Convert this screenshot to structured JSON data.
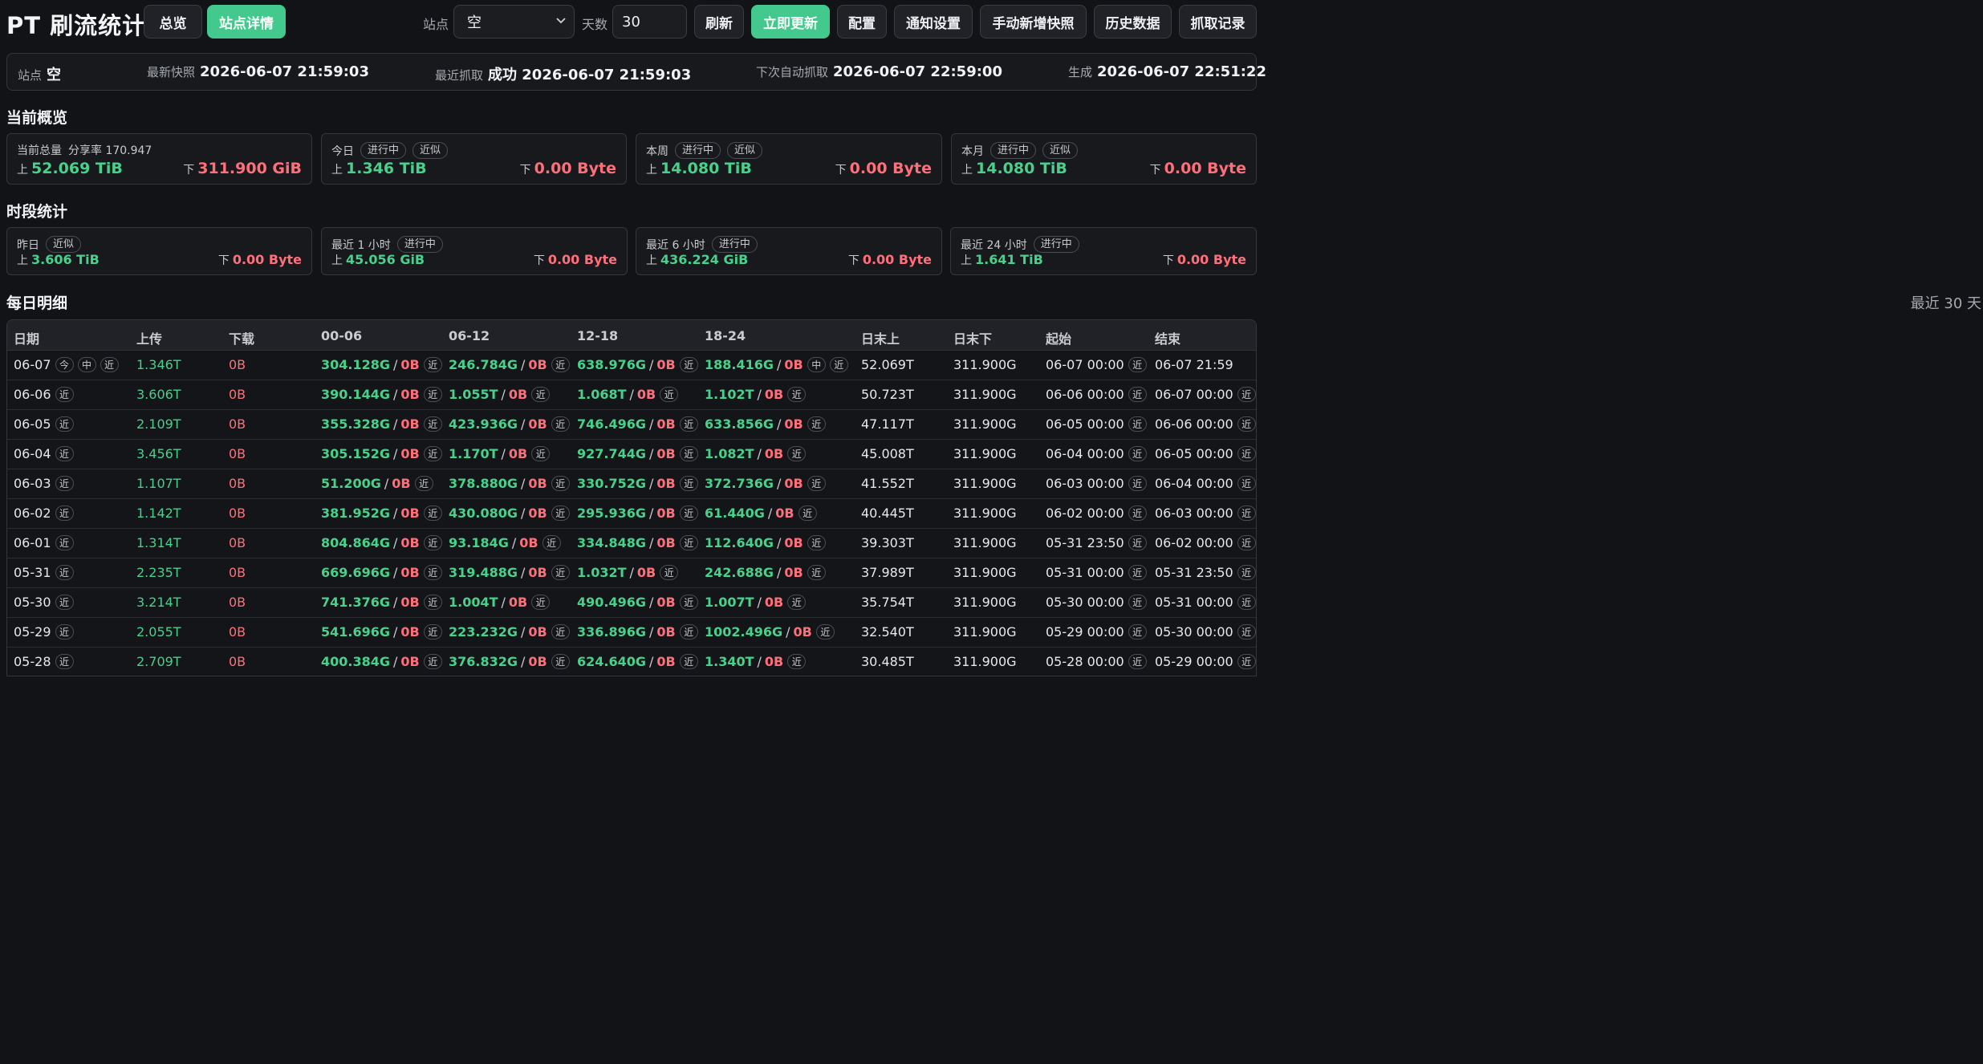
{
  "app": {
    "title": "PT 刷流统计"
  },
  "toolbar": {
    "overview": "总览",
    "site_detail": "站点详情",
    "site_label": "站点",
    "site_value": "空",
    "days_label": "天数",
    "days_value": "30",
    "refresh": "刷新",
    "update_now": "立即更新",
    "config": "配置",
    "notify": "通知设置",
    "manual_snapshot": "手动新增快照",
    "history": "历史数据",
    "fetch_log": "抓取记录"
  },
  "info": {
    "site_label": "站点",
    "site_value": "空",
    "latest_label": "最新快照",
    "latest_value": "2026-06-07 21:59:03",
    "fetch_label": "最近抓取",
    "fetch_value": "成功 2026-06-07 21:59:03",
    "next_label": "下次自动抓取",
    "next_value": "2026-06-07 22:59:00",
    "gen_label": "生成",
    "gen_value": "2026-06-07 22:51:22"
  },
  "sections": {
    "overview": "当前概览",
    "period": "时段统计",
    "daily": "每日明细",
    "recent": "最近 30 天"
  },
  "common": {
    "up": "上",
    "down": "下",
    "in_progress": "进行中",
    "approx": "近似"
  },
  "overview": {
    "total": {
      "label": "当前总量",
      "ratio": "分享率 170.947",
      "up": "52.069 TiB",
      "down": "311.900 GiB"
    },
    "today": {
      "label": "今日",
      "up": "1.346 TiB",
      "down": "0.00 Byte"
    },
    "week": {
      "label": "本周",
      "up": "14.080 TiB",
      "down": "0.00 Byte"
    },
    "month": {
      "label": "本月",
      "up": "14.080 TiB",
      "down": "0.00 Byte"
    }
  },
  "period": {
    "yesterday": {
      "label": "昨日",
      "up": "3.606 TiB",
      "down": "0.00 Byte"
    },
    "h1": {
      "label": "最近 1 小时",
      "up": "45.056 GiB",
      "down": "0.00 Byte"
    },
    "h6": {
      "label": "最近 6 小时",
      "up": "436.224 GiB",
      "down": "0.00 Byte"
    },
    "h24": {
      "label": "最近 24 小时",
      "up": "1.641 TiB",
      "down": "0.00 Byte"
    }
  },
  "table": {
    "headers": [
      "日期",
      "上传",
      "下载",
      "00-06",
      "06-12",
      "12-18",
      "18-24",
      "日末上",
      "日末下",
      "起始",
      "结束"
    ],
    "marks": {
      "today": "今",
      "mid": "中",
      "approx": "近"
    },
    "rows": [
      {
        "date": "06-07",
        "up": "1.346T",
        "down": "0B",
        "s1": "304.128G",
        "s2": "246.784G",
        "s3": "638.976G",
        "s4": "188.416G",
        "eu": "52.069T",
        "ed": "311.900G",
        "start": "06-07 00:00",
        "end": "06-07 21:59"
      },
      {
        "date": "06-06",
        "up": "3.606T",
        "down": "0B",
        "s1": "390.144G",
        "s2": "1.055T",
        "s3": "1.068T",
        "s4": "1.102T",
        "eu": "50.723T",
        "ed": "311.900G",
        "start": "06-06 00:00",
        "end": "06-07 00:00"
      },
      {
        "date": "06-05",
        "up": "2.109T",
        "down": "0B",
        "s1": "355.328G",
        "s2": "423.936G",
        "s3": "746.496G",
        "s4": "633.856G",
        "eu": "47.117T",
        "ed": "311.900G",
        "start": "06-05 00:00",
        "end": "06-06 00:00"
      },
      {
        "date": "06-04",
        "up": "3.456T",
        "down": "0B",
        "s1": "305.152G",
        "s2": "1.170T",
        "s3": "927.744G",
        "s4": "1.082T",
        "eu": "45.008T",
        "ed": "311.900G",
        "start": "06-04 00:00",
        "end": "06-05 00:00"
      },
      {
        "date": "06-03",
        "up": "1.107T",
        "down": "0B",
        "s1": "51.200G",
        "s2": "378.880G",
        "s3": "330.752G",
        "s4": "372.736G",
        "eu": "41.552T",
        "ed": "311.900G",
        "start": "06-03 00:00",
        "end": "06-04 00:00"
      },
      {
        "date": "06-02",
        "up": "1.142T",
        "down": "0B",
        "s1": "381.952G",
        "s2": "430.080G",
        "s3": "295.936G",
        "s4": "61.440G",
        "eu": "40.445T",
        "ed": "311.900G",
        "start": "06-02 00:00",
        "end": "06-03 00:00"
      },
      {
        "date": "06-01",
        "up": "1.314T",
        "down": "0B",
        "s1": "804.864G",
        "s2": "93.184G",
        "s3": "334.848G",
        "s4": "112.640G",
        "eu": "39.303T",
        "ed": "311.900G",
        "start": "05-31 23:50",
        "end": "06-02 00:00"
      },
      {
        "date": "05-31",
        "up": "2.235T",
        "down": "0B",
        "s1": "669.696G",
        "s2": "319.488G",
        "s3": "1.032T",
        "s4": "242.688G",
        "eu": "37.989T",
        "ed": "311.900G",
        "start": "05-31 00:00",
        "end": "05-31 23:50"
      },
      {
        "date": "05-30",
        "up": "3.214T",
        "down": "0B",
        "s1": "741.376G",
        "s2": "1.004T",
        "s3": "490.496G",
        "s4": "1.007T",
        "eu": "35.754T",
        "ed": "311.900G",
        "start": "05-30 00:00",
        "end": "05-31 00:00"
      },
      {
        "date": "05-29",
        "up": "2.055T",
        "down": "0B",
        "s1": "541.696G",
        "s2": "223.232G",
        "s3": "336.896G",
        "s4": "1002.496G",
        "eu": "32.540T",
        "ed": "311.900G",
        "start": "05-29 00:00",
        "end": "05-30 00:00"
      },
      {
        "date": "05-28",
        "up": "2.709T",
        "down": "0B",
        "s1": "400.384G",
        "s2": "376.832G",
        "s3": "624.640G",
        "s4": "1.340T",
        "eu": "30.485T",
        "ed": "311.900G",
        "start": "05-28 00:00",
        "end": "05-29 00:00"
      }
    ]
  }
}
